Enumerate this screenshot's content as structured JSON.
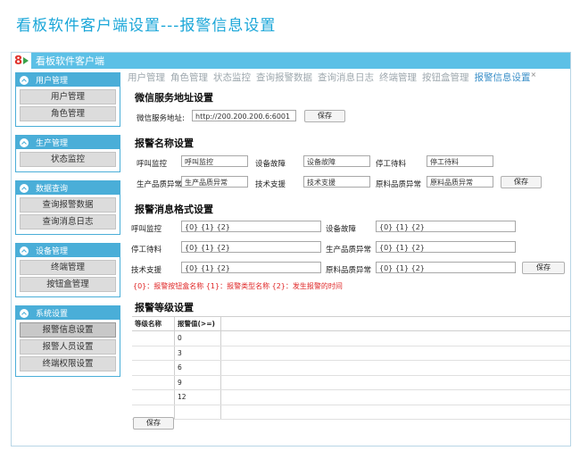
{
  "page_title": "看板软件客户端设置---报警信息设置",
  "app": {
    "name": "看板软件客户端"
  },
  "sidebar": {
    "groups": [
      {
        "title": "用户管理",
        "items": [
          "用户管理",
          "角色管理"
        ]
      },
      {
        "title": "生产管理",
        "items": [
          "状态监控"
        ]
      },
      {
        "title": "数据查询",
        "items": [
          "查询报警数据",
          "查询消息日志"
        ]
      },
      {
        "title": "设备管理",
        "items": [
          "终端管理",
          "按钮盒管理"
        ]
      },
      {
        "title": "系统设置",
        "items": [
          "报警信息设置",
          "报警人员设置",
          "终端权限设置"
        ]
      }
    ]
  },
  "tabs": [
    "用户管理",
    "角色管理",
    "状态监控",
    "查询报警数据",
    "查询消息日志",
    "终端管理",
    "按钮盒管理",
    "报警信息设置"
  ],
  "tab_close": "×",
  "wechat": {
    "title": "微信服务地址设置",
    "label": "微信服务地址:",
    "value": "http://200.200.200.6:6001",
    "save": "保存"
  },
  "alarm_names": {
    "title": "报警名称设置",
    "fields": [
      {
        "label": "呼叫监控",
        "value": "呼叫监控"
      },
      {
        "label": "设备故障",
        "value": "设备故障"
      },
      {
        "label": "停工待料",
        "value": "停工待料"
      },
      {
        "label": "生产品质异常",
        "value": "生产品质异常"
      },
      {
        "label": "技术支援",
        "value": "技术支援"
      },
      {
        "label": "原料品质异常",
        "value": "原料品质异常"
      }
    ],
    "save": "保存"
  },
  "alarm_format": {
    "title": "报警消息格式设置",
    "fields": [
      {
        "label": "呼叫监控",
        "value": "{0} {1} {2}"
      },
      {
        "label": "设备故障",
        "value": "{0} {1} {2}"
      },
      {
        "label": "停工待料",
        "value": "{0} {1} {2}"
      },
      {
        "label": "生产品质异常",
        "value": "{0} {1} {2}"
      },
      {
        "label": "技术支援",
        "value": "{0} {1} {2}"
      },
      {
        "label": "原料品质异常",
        "value": "{0} {1} {2}"
      }
    ],
    "hint": "{0}：报警按钮盒名称  {1}：报警类型名称  {2}：发生报警的时间",
    "save": "保存"
  },
  "alarm_level": {
    "title": "报警等级设置",
    "columns": [
      "等级名称",
      "报警值(>=)"
    ],
    "rows": [
      {
        "name": "",
        "value": "0"
      },
      {
        "name": "",
        "value": "3"
      },
      {
        "name": "",
        "value": "6"
      },
      {
        "name": "",
        "value": "9"
      },
      {
        "name": "",
        "value": "12"
      },
      {
        "name": "",
        "value": ""
      }
    ],
    "save": "保存"
  }
}
